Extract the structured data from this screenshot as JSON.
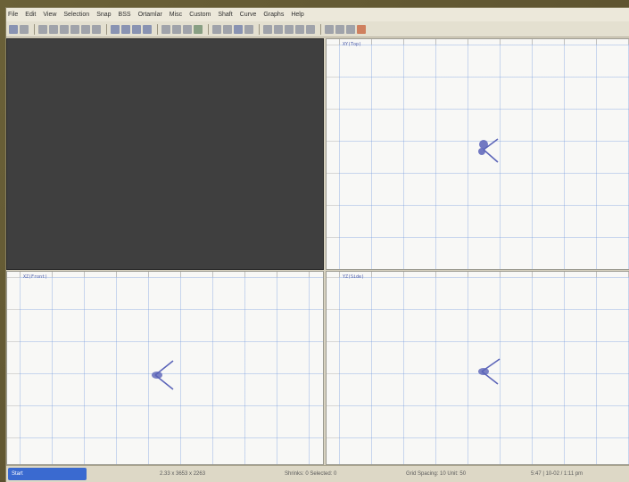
{
  "menu": {
    "items": [
      "File",
      "Edit",
      "View",
      "Selection",
      "Snap",
      "BSS",
      "Ortamlar",
      "Misc",
      "Custom",
      "Shaft",
      "Curve",
      "Graphs",
      "Help"
    ]
  },
  "viewports": [
    {
      "id": "perspective",
      "label": "",
      "dark": true
    },
    {
      "id": "top",
      "label": "XY(Top)",
      "dark": false
    },
    {
      "id": "front",
      "label": "XZ(Front)",
      "dark": false
    },
    {
      "id": "side",
      "label": "YZ(Side)",
      "dark": false
    }
  ],
  "statusbar": {
    "start_label": "Start",
    "coords": "2.33 x 3653 x 2263",
    "mode": "Shrinks: 0 Selected: 0",
    "grid": "Grid Spacing: 10 Unit: 50",
    "time": "5:47 | 10-02 / 1:11 pm"
  },
  "colors": {
    "accent": "#4a5aa8",
    "grid": "#6e96dc",
    "dark_viewport": "#3f3f3f"
  }
}
